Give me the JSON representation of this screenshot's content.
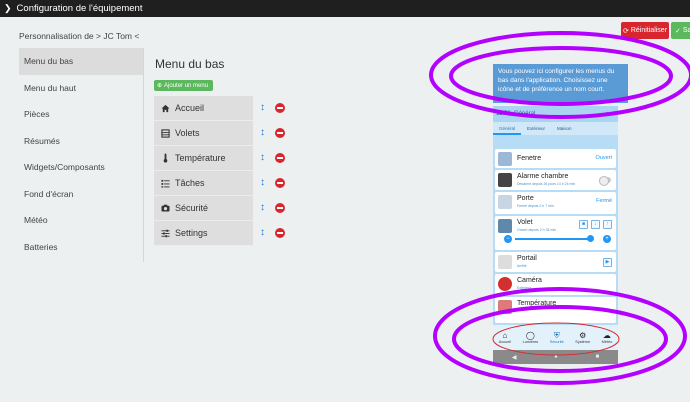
{
  "window": {
    "title": "Configuration de l'équipement"
  },
  "actions": {
    "reset_label": "Réinitialiser",
    "save_label": "Sa"
  },
  "breadcrumb": "Personnalisation de > JC Tom <",
  "sidebar": {
    "items": [
      {
        "label": "Menu du bas",
        "active": true
      },
      {
        "label": "Menu du haut"
      },
      {
        "label": "Pièces"
      },
      {
        "label": "Résumés"
      },
      {
        "label": "Widgets/Composants"
      },
      {
        "label": "Fond d'écran"
      },
      {
        "label": "Météo"
      },
      {
        "label": "Batteries"
      }
    ]
  },
  "main": {
    "title": "Menu du bas",
    "add_button": "Ajouter un menu",
    "menu_items": [
      {
        "label": "Accueil",
        "icon": "home-icon"
      },
      {
        "label": "Volets",
        "icon": "shutter-icon"
      },
      {
        "label": "Température",
        "icon": "thermometer-icon"
      },
      {
        "label": "Tâches",
        "icon": "tasks-icon"
      },
      {
        "label": "Sécurité",
        "icon": "camera-icon"
      },
      {
        "label": "Settings",
        "icon": "sliders-icon"
      }
    ]
  },
  "tooltip": "Vous pouvez ici configurer les menus du bas dans l'application. Choisissez une icône et de préférence un nom court.",
  "phone": {
    "status_time": "11:52",
    "status_title": "Général",
    "tabs": [
      "Général",
      "Extérieur",
      "Maison"
    ],
    "cards": [
      {
        "title": "Fenetre",
        "value": "Ouvert",
        "subtitle": ""
      },
      {
        "title": "Alarme chambre",
        "value": "",
        "subtitle": "Désarmé depuis 26 jours 14 h 24 min"
      },
      {
        "title": "Porte",
        "value": "Fermé",
        "subtitle": "Fermé depuis 2 h 7 min"
      },
      {
        "title": "Volet",
        "value": "",
        "subtitle": "Ouvert depuis 2 h 33 min"
      },
      {
        "title": "Portail",
        "value": "",
        "subtitle": "Arrêté"
      },
      {
        "title": "Caméra",
        "value": "",
        "subtitle": "Extérieur"
      },
      {
        "title": "Température",
        "value": "",
        "subtitle": ""
      }
    ],
    "slider_level": 0.92,
    "bottom_nav": [
      {
        "label": "Accueil",
        "icon": "home-icon"
      },
      {
        "label": "Lumières",
        "icon": "bulb-icon"
      },
      {
        "label": "Sécurité",
        "icon": "shield-icon",
        "active": true
      },
      {
        "label": "Système",
        "icon": "gear-icon"
      },
      {
        "label": "Météo",
        "icon": "weather-icon"
      }
    ]
  },
  "colors": {
    "accent_blue": "#2196f3",
    "danger_red": "#d9262e",
    "success_green": "#5cb85c",
    "annotation_purple": "#b300ff"
  }
}
